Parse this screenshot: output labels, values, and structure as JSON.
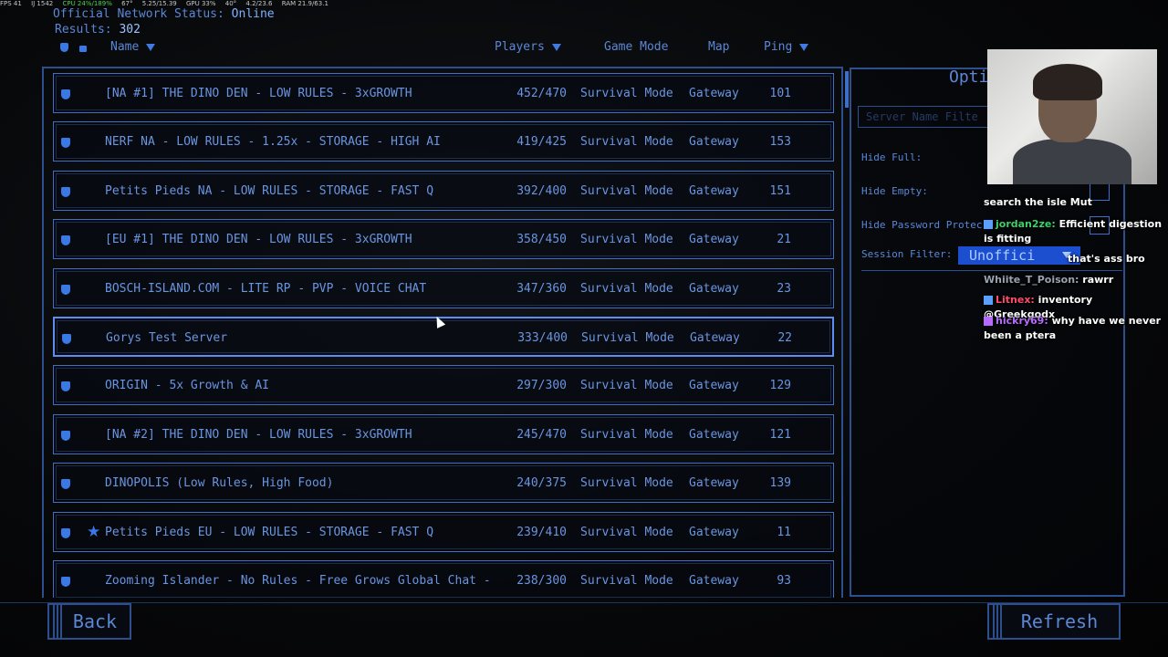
{
  "hud": {
    "fps": "FPS 41",
    "a": "Ĳ 1542",
    "cpu": "CPU 24%/189%",
    "temp1": "67°",
    "mem": "5.25/15.39",
    "gpu": "GPU 33%",
    "temp2": "40°",
    "vram": "4.2/23.6",
    "ram": "RAM 21.9/63.1"
  },
  "status": {
    "label": "Official Network Status:",
    "value": "Online"
  },
  "results": {
    "label": "Results:",
    "value": "302"
  },
  "columns": {
    "name": "Name",
    "players": "Players",
    "mode": "Game Mode",
    "map": "Map",
    "ping": "Ping"
  },
  "servers": [
    {
      "name": "[NA #1] THE DINO DEN - LOW RULES - 3xGROWTH",
      "players": "452/470",
      "mode": "Survival Mode",
      "map": "Gateway",
      "ping": "101",
      "fav": false
    },
    {
      "name": "NERF NA - LOW RULES - 1.25x - STORAGE - HIGH AI",
      "players": "419/425",
      "mode": "Survival Mode",
      "map": "Gateway",
      "ping": "153",
      "fav": false
    },
    {
      "name": "Petits Pieds NA - LOW RULES - STORAGE - FAST Q",
      "players": "392/400",
      "mode": "Survival Mode",
      "map": "Gateway",
      "ping": "151",
      "fav": false
    },
    {
      "name": "[EU #1] THE DINO DEN - LOW RULES - 3xGROWTH",
      "players": "358/450",
      "mode": "Survival Mode",
      "map": "Gateway",
      "ping": "21",
      "fav": false
    },
    {
      "name": "BOSCH-ISLAND.COM - LITE RP - PVP - VOICE CHAT",
      "players": "347/360",
      "mode": "Survival Mode",
      "map": "Gateway",
      "ping": "23",
      "fav": false
    },
    {
      "name": "Gorys Test Server",
      "players": "333/400",
      "mode": "Survival Mode",
      "map": "Gateway",
      "ping": "22",
      "fav": false
    },
    {
      "name": "ORIGIN - 5x Growth & AI",
      "players": "297/300",
      "mode": "Survival Mode",
      "map": "Gateway",
      "ping": "129",
      "fav": false
    },
    {
      "name": "[NA #2] THE DINO DEN - LOW RULES - 3xGROWTH",
      "players": "245/470",
      "mode": "Survival Mode",
      "map": "Gateway",
      "ping": "121",
      "fav": false
    },
    {
      "name": "DINOPOLIS (Low Rules, High Food)",
      "players": "240/375",
      "mode": "Survival Mode",
      "map": "Gateway",
      "ping": "139",
      "fav": false
    },
    {
      "name": "Petits Pieds EU - LOW RULES - STORAGE - FAST Q",
      "players": "239/410",
      "mode": "Survival Mode",
      "map": "Gateway",
      "ping": "11",
      "fav": true
    },
    {
      "name": "Zooming Islander - No Rules - Free Grows  Global Chat -",
      "players": "238/300",
      "mode": "Survival Mode",
      "map": "Gateway",
      "ping": "93",
      "fav": false
    }
  ],
  "options": {
    "title": "Opti",
    "filter_placeholder": "Server Name Filte",
    "hide_full": "Hide Full:",
    "hide_empty": "Hide Empty:",
    "hide_password": "Hide Password Protec",
    "session_filter": "Session Filter:",
    "session_value": "Unoffici"
  },
  "chat": [
    {
      "user": "",
      "text": "search the isle Mut"
    },
    {
      "user": "jordan2ze:",
      "text": "Efficient digestion is fitting"
    },
    {
      "user": "",
      "text": "that's ass bro"
    },
    {
      "user": "Whiite_T_Poison:",
      "text": "rawrr"
    },
    {
      "user": "Litnex:",
      "text": "inventory @Greekgodx"
    },
    {
      "user": "hickry69:",
      "text": "why have we never been a ptera"
    }
  ],
  "buttons": {
    "back": "Back",
    "refresh": "Refresh"
  }
}
